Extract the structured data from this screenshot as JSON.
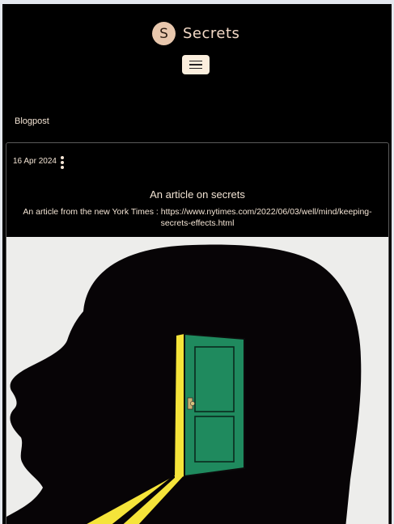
{
  "brand": {
    "avatar_letter": "S",
    "name": "Secrets"
  },
  "breadcrumb": "Blogpost",
  "post": {
    "date": "16 Apr 2024",
    "title": "An article on secrets",
    "description": "An article from the new York Times : https://www.nytimes.com/2022/06/03/well/mind/keeping-secrets-effects.html"
  },
  "illustration": {
    "subject": "head silhouette with open green door emitting yellow light",
    "colors": {
      "background": "#ededeb",
      "silhouette": "#070406",
      "door": "#1f8a5e",
      "light": "#f5e43a"
    }
  }
}
